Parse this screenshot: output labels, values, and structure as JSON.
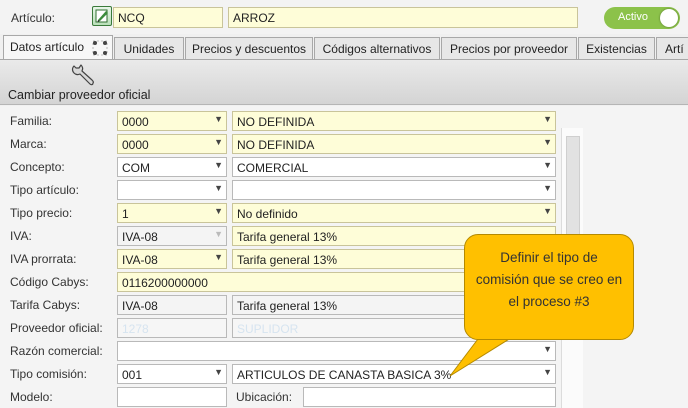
{
  "header": {
    "articulo_label": "Artículo:",
    "code": "NCQ",
    "name": "ARROZ",
    "status": "Activo",
    "status_color": "#8cc24a"
  },
  "tabs": [
    {
      "label": "Datos artículo",
      "active": true
    },
    {
      "label": "Unidades"
    },
    {
      "label": "Precios y descuentos"
    },
    {
      "label": "Códigos alternativos"
    },
    {
      "label": "Precios por proveedor"
    },
    {
      "label": "Existencias"
    },
    {
      "label": "Artí"
    }
  ],
  "toolbar": {
    "cambiar_label": "Cambiar proveedor oficial",
    "icon": "wrench-icon"
  },
  "form": {
    "familia": {
      "label": "Familia:",
      "code": "0000",
      "desc": "NO DEFINIDA"
    },
    "marca": {
      "label": "Marca:",
      "code": "0000",
      "desc": "NO DEFINIDA"
    },
    "concepto": {
      "label": "Concepto:",
      "code": "COM",
      "desc": "COMERCIAL"
    },
    "tipo_articulo": {
      "label": "Tipo artículo:",
      "code": "",
      "desc": ""
    },
    "tipo_precio": {
      "label": "Tipo precio:",
      "code": "1",
      "desc": "No definido"
    },
    "iva": {
      "label": "IVA:",
      "code": "IVA-08",
      "desc": "Tarifa general 13%"
    },
    "iva_prorrata": {
      "label": "IVA prorrata:",
      "code": "IVA-08",
      "desc": "Tarifa general 13%"
    },
    "codigo_cabys": {
      "label": "Código Cabys:",
      "value": "0116200000000"
    },
    "tarifa_cabys": {
      "label": "Tarifa Cabys:",
      "code": "IVA-08",
      "desc": "Tarifa general 13%"
    },
    "proveedor_oficial": {
      "label": "Proveedor oficial:",
      "code": "1278",
      "desc": "SUPLIDOR"
    },
    "razon_comercial": {
      "label": "Razón comercial:",
      "value": ""
    },
    "tipo_comision": {
      "label": "Tipo comisión:",
      "code": "001",
      "desc": "ARTICULOS DE CANASTA BASICA 3%"
    },
    "modelo": {
      "label": "Modelo:",
      "value": ""
    },
    "ubicacion": {
      "label": "Ubicación:",
      "value": ""
    }
  },
  "callout": {
    "text": "Definir el tipo de comisión que se creo en el proceso #3",
    "color": "#ffc000"
  }
}
